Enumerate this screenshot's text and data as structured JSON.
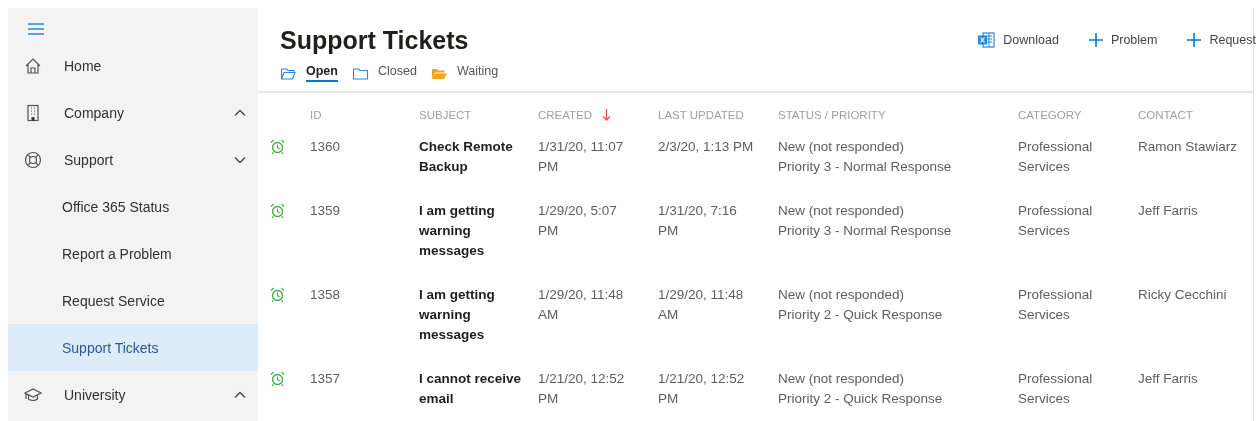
{
  "sidebar": {
    "items": [
      {
        "label": "Home",
        "kind": "link",
        "selected": false
      },
      {
        "label": "Company",
        "kind": "group",
        "expanded": false,
        "selected": false
      },
      {
        "label": "Support",
        "kind": "group",
        "expanded": true,
        "selected": false,
        "children": [
          {
            "label": "Office 365 Status",
            "selected": false
          },
          {
            "label": "Report a Problem",
            "selected": false
          },
          {
            "label": "Request Service",
            "selected": false
          },
          {
            "label": "Support Tickets",
            "selected": true
          }
        ]
      },
      {
        "label": "University",
        "kind": "group",
        "expanded": false,
        "selected": false
      }
    ]
  },
  "page": {
    "title": "Support Tickets",
    "tabs": [
      {
        "label": "Open",
        "selected": true
      },
      {
        "label": "Closed",
        "selected": false
      },
      {
        "label": "Waiting",
        "selected": false
      }
    ],
    "actions": [
      {
        "label": "Download",
        "kind": "excel"
      },
      {
        "label": "Problem",
        "kind": "add"
      },
      {
        "label": "Request",
        "kind": "add"
      }
    ]
  },
  "table": {
    "columns": [
      {
        "label": "ID",
        "sorted": false
      },
      {
        "label": "SUBJECT",
        "sorted": false
      },
      {
        "label": "CREATED",
        "sorted": true
      },
      {
        "label": "LAST UPDATED",
        "sorted": false
      },
      {
        "label": "STATUS / PRIORITY",
        "sorted": false
      },
      {
        "label": "CATEGORY",
        "sorted": false
      },
      {
        "label": "CONTACT",
        "sorted": false
      }
    ],
    "rows": [
      {
        "id": "1360",
        "subject": "Check Remote Backup",
        "created": "1/31/20, 11:07 PM",
        "updated": "2/3/20, 1:13 PM",
        "status": "New (not responded)",
        "priority": "Priority 3 - Normal Response",
        "category": "Professional Services",
        "contact": "Ramon Stawiarz"
      },
      {
        "id": "1359",
        "subject": "I am getting warning messages",
        "created": "1/29/20, 5:07 PM",
        "updated": "1/31/20, 7:16 PM",
        "status": "New (not responded)",
        "priority": "Priority 3 - Normal Response",
        "category": "Professional Services",
        "contact": "Jeff Farris"
      },
      {
        "id": "1358",
        "subject": "I am getting warning messages",
        "created": "1/29/20, 11:48 AM",
        "updated": "1/29/20, 11:48 AM",
        "status": "New (not responded)",
        "priority": "Priority 2 - Quick Response",
        "category": "Professional Services",
        "contact": "Ricky Cecchini"
      },
      {
        "id": "1357",
        "subject": "I cannot receive email",
        "created": "1/21/20, 12:52 PM",
        "updated": "1/21/20, 12:52 PM",
        "status": "New (not responded)",
        "priority": "Priority 2 - Quick Response",
        "category": "Professional Services",
        "contact": "Jeff Farris"
      }
    ]
  }
}
